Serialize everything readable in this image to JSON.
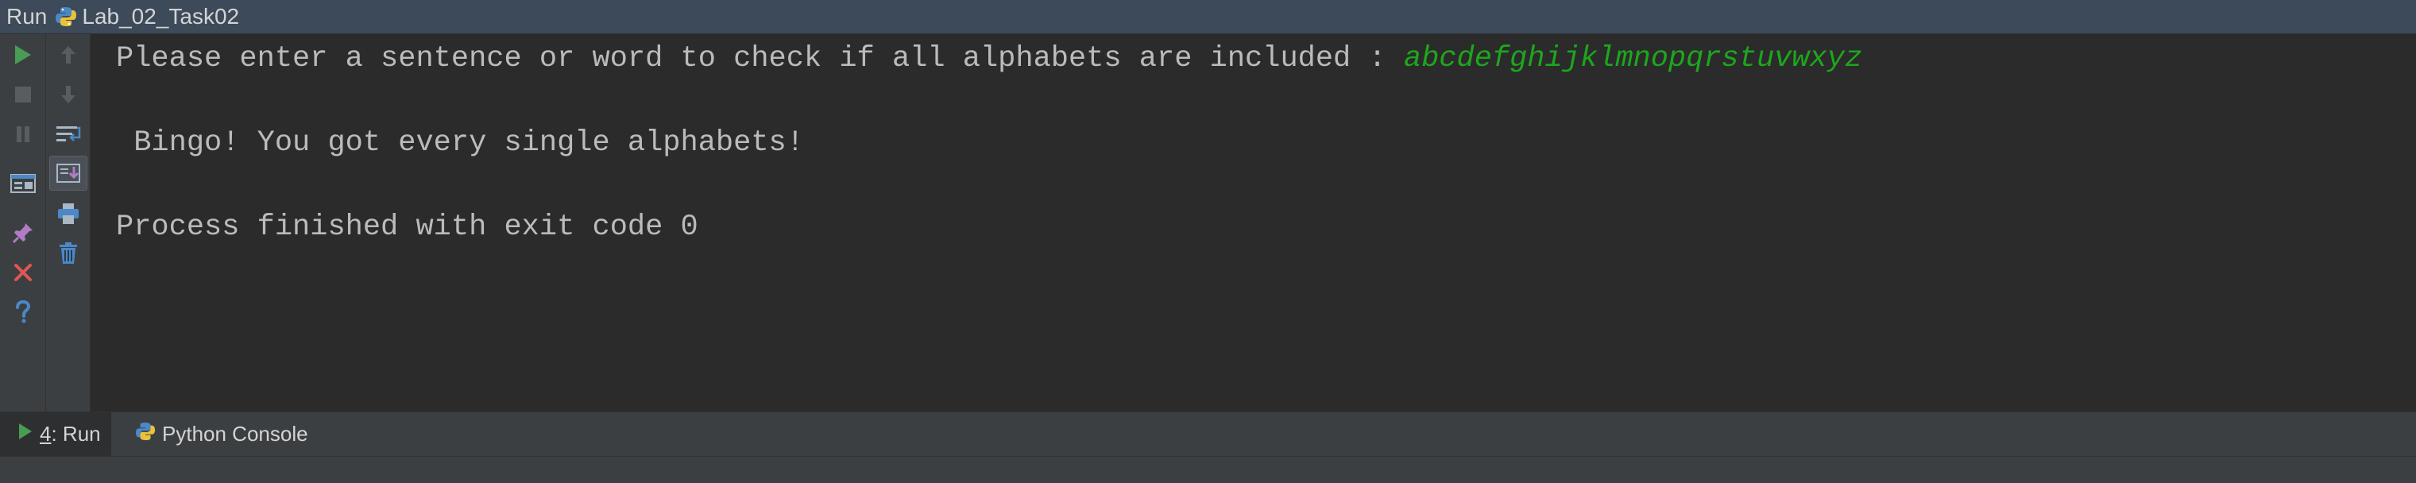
{
  "titlebar": {
    "label": "Run",
    "config_name": "Lab_02_Task02"
  },
  "toolbar": {
    "primary": [
      "rerun-icon",
      "stop-icon",
      "pause-icon",
      "layout-icon",
      "pin-icon",
      "close-icon",
      "help-icon"
    ],
    "secondary": [
      "scroll-up-icon",
      "scroll-down-icon",
      "soft-wrap-icon",
      "scroll-to-end-icon",
      "print-icon",
      "clear-all-icon"
    ]
  },
  "console": {
    "prompt": "Please enter a sentence or word to check if all alphabets are included : ",
    "user_input": "abcdefghijklmnopqrstuvwxyz",
    "output": " Bingo! You got every single alphabets!",
    "exit_message": "Process finished with exit code 0"
  },
  "bottom_tabs": {
    "run_number": "4",
    "run_label": ": Run",
    "python_console": "Python Console"
  },
  "colors": {
    "user_input": "#1da61d",
    "console_text": "#bbbbbb",
    "background": "#2b2b2b",
    "run_green": "#499c54"
  }
}
